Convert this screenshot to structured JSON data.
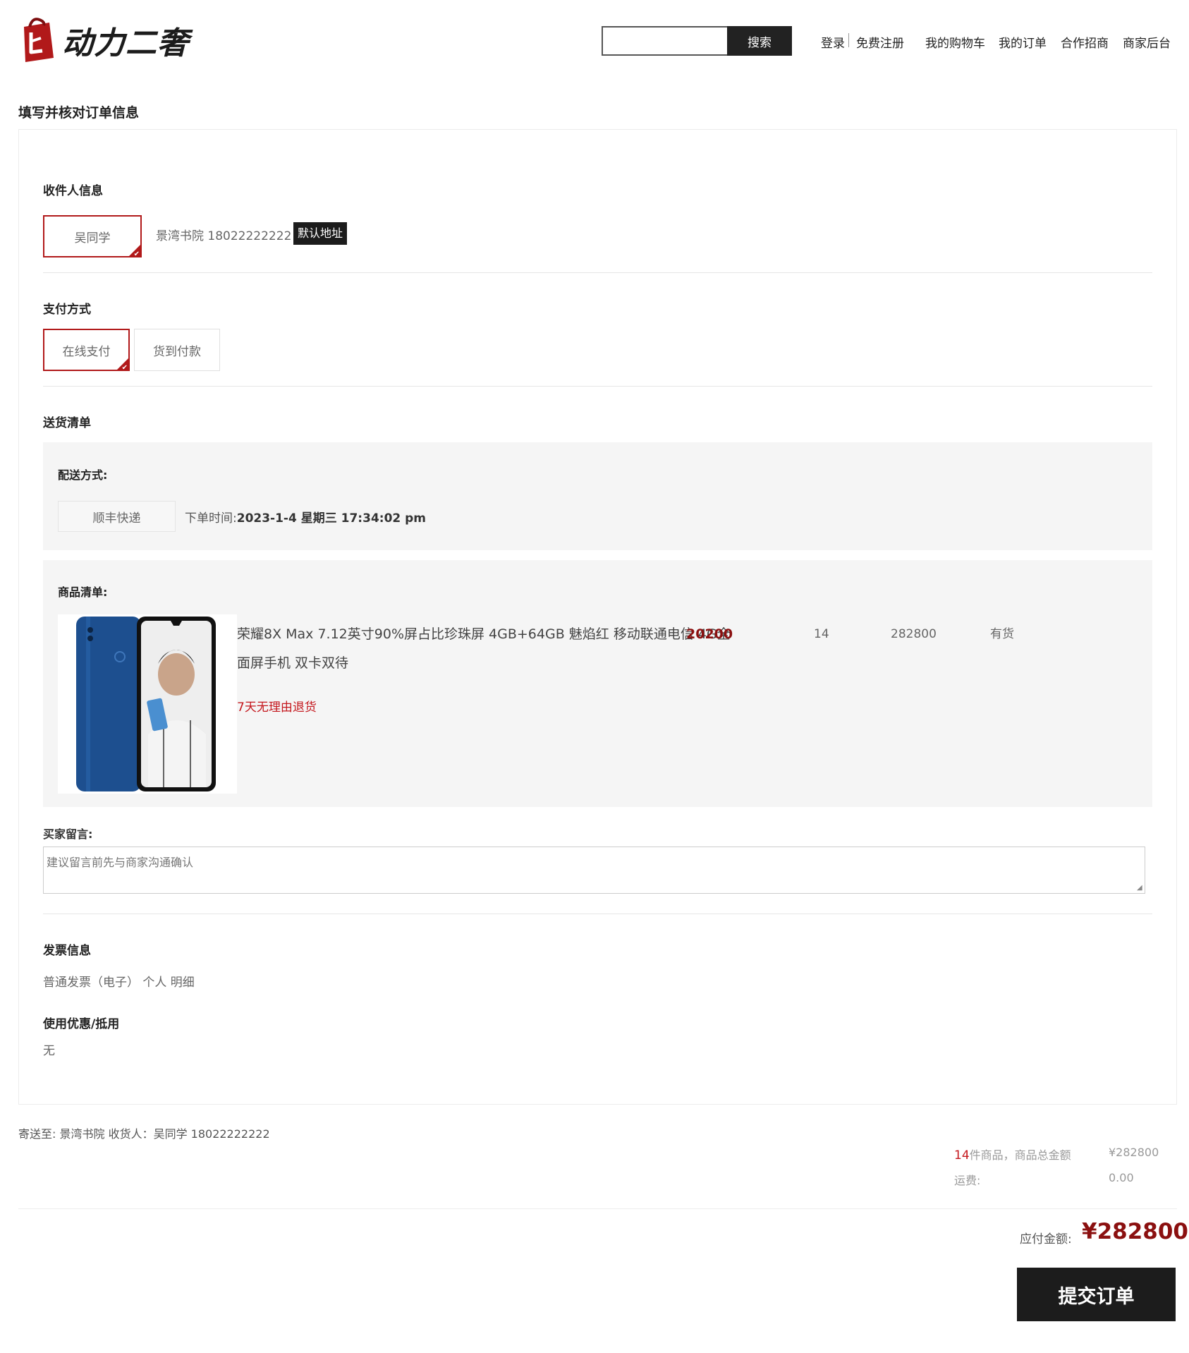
{
  "brand": {
    "name": "动力二奢",
    "accent": "#b1191a"
  },
  "header": {
    "search_placeholder": "",
    "search_button": "搜索",
    "nav": {
      "login": "登录",
      "register": "免费注册",
      "cart": "我的购物车",
      "orders": "我的订单",
      "partners": "合作招商",
      "merchant": "商家后台"
    }
  },
  "page": {
    "title": "填写并核对订单信息"
  },
  "receiver": {
    "section_title": "收件人信息",
    "name": "吴同学",
    "address_phone": "景湾书院 18022222222",
    "default_badge": "默认地址"
  },
  "payment": {
    "section_title": "支付方式",
    "options": [
      {
        "label": "在线支付",
        "selected": true
      },
      {
        "label": "货到付款",
        "selected": false
      }
    ]
  },
  "delivery": {
    "section_title": "送货清单",
    "method_label": "配送方式:",
    "method": "顺丰快递",
    "order_time_label": "下单时间:",
    "order_time": "2023-1-4 星期三 17:34:02 pm"
  },
  "items": {
    "label": "商品清单:",
    "list": [
      {
        "name": "荣耀8X Max 7.12英寸90%屏占比珍珠屏 4GB+64GB 魅焰红 移动联通电信 4G全面屏手机 双卡双待",
        "price": "20200",
        "quantity": "14",
        "subtotal": "282800",
        "stock": "有货",
        "return_policy": "7天无理由退货",
        "image_icon": "phone-product-image"
      }
    ]
  },
  "message": {
    "label": "买家留言:",
    "placeholder": "建议留言前先与商家沟通确认"
  },
  "invoice": {
    "section_title": "发票信息",
    "text": "普通发票（电子） 个人 明细"
  },
  "coupon": {
    "section_title": "使用优惠/抵用",
    "text": "无"
  },
  "summary": {
    "ship_to": "寄送至: 景湾书院 收货人：吴同学 18022222222",
    "count": "14",
    "count_suffix": "件商品，商品总金额",
    "goods_total": "¥282800",
    "freight_label": "运费:",
    "freight": "0.00",
    "payable_label": "应付金额:",
    "payable": "¥282800",
    "submit": "提交订单"
  }
}
